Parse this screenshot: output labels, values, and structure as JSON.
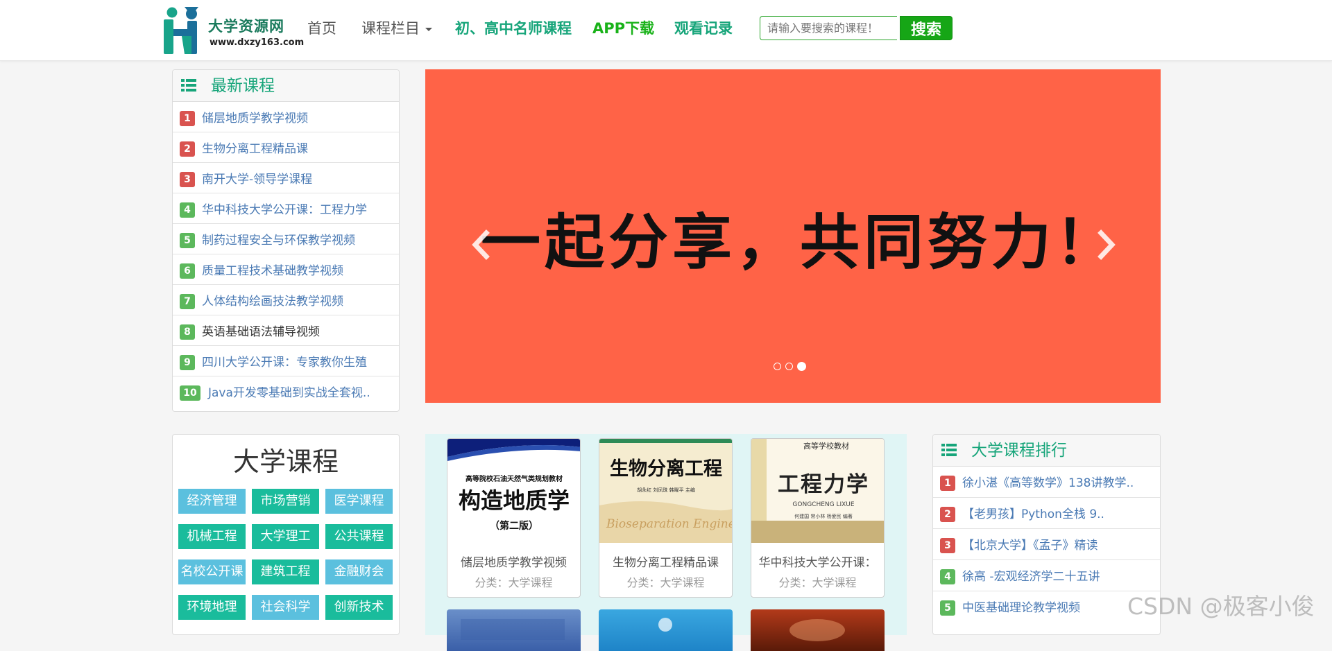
{
  "site": {
    "logo_text": "大学资源网",
    "logo_url": "www.dxzy163.com"
  },
  "nav": {
    "home": "首页",
    "columns": "课程栏目",
    "teachers": "初、高中名师课程",
    "app": "APP下载",
    "history": "观看记录"
  },
  "search": {
    "placeholder": "请输入要搜索的课程！",
    "button": "搜索"
  },
  "latest": {
    "title": "最新课程",
    "items": [
      {
        "num": "1",
        "label": "储层地质学教学视频"
      },
      {
        "num": "2",
        "label": "生物分离工程精品课"
      },
      {
        "num": "3",
        "label": "南开大学-领导学课程"
      },
      {
        "num": "4",
        "label": "华中科技大学公开课：工程力学"
      },
      {
        "num": "5",
        "label": "制药过程安全与环保教学视频"
      },
      {
        "num": "6",
        "label": "质量工程技术基础教学视频"
      },
      {
        "num": "7",
        "label": "人体结构绘画技法教学视频"
      },
      {
        "num": "8",
        "label": "英语基础语法辅导视频"
      },
      {
        "num": "9",
        "label": "四川大学公开课：专家教你生殖"
      },
      {
        "num": "10",
        "label": "Java开发零基础到实战全套视.."
      }
    ]
  },
  "carousel": {
    "slogan": "一起分享，共同努力！",
    "active_slide": 3,
    "slide_count": 3
  },
  "categories": {
    "title": "大学课程",
    "tags": [
      "经济管理",
      "市场营销",
      "医学课程",
      "机械工程",
      "大学理工",
      "公共课程",
      "名校公开课",
      "建筑工程",
      "金融财会",
      "环境地理",
      "社会科学",
      "创新技术"
    ]
  },
  "courses": [
    {
      "title": "储层地质学教学视频",
      "category": "分类：大学课程",
      "cover": {
        "small": "高等院校石油天然气类规划教材",
        "big": "构造地质学",
        "edition": "（第二版）"
      }
    },
    {
      "title": "生物分离工程精品课",
      "category": "分类：大学课程",
      "cover": {
        "big": "生物分离工程",
        "authors": "胡永红  刘凤珠  韩曜平  主编",
        "script": "Bioseparation Engineering"
      }
    },
    {
      "title": "华中科技大学公开课：",
      "category": "分类：大学课程",
      "cover": {
        "small": "高等学校教材",
        "big": "工程力学",
        "pinyin": "GONGCHENG  LIXUE",
        "authors": "何建国  常小林  杨爱民  编著"
      }
    }
  ],
  "ranking": {
    "title": "大学课程排行",
    "items": [
      {
        "num": "1",
        "label": "徐小湛《高等数学》138讲教学.."
      },
      {
        "num": "2",
        "label": "【老男孩】Python全栈 9.."
      },
      {
        "num": "3",
        "label": "【北京大学】《孟子》精读"
      },
      {
        "num": "4",
        "label": "徐高 -宏观经济学二十五讲"
      },
      {
        "num": "5",
        "label": "中医基础理论教学视频"
      }
    ]
  },
  "watermark": "CSDN @极客小俊",
  "colors": {
    "brand_teal": "#17a57a",
    "brand_green": "#16a616",
    "carousel_bg": "#ff6347",
    "badge_red": "#d9534f",
    "badge_green": "#5cb85c",
    "tag_blue": "#5bc0de",
    "tag_teal": "#1abc9c"
  }
}
